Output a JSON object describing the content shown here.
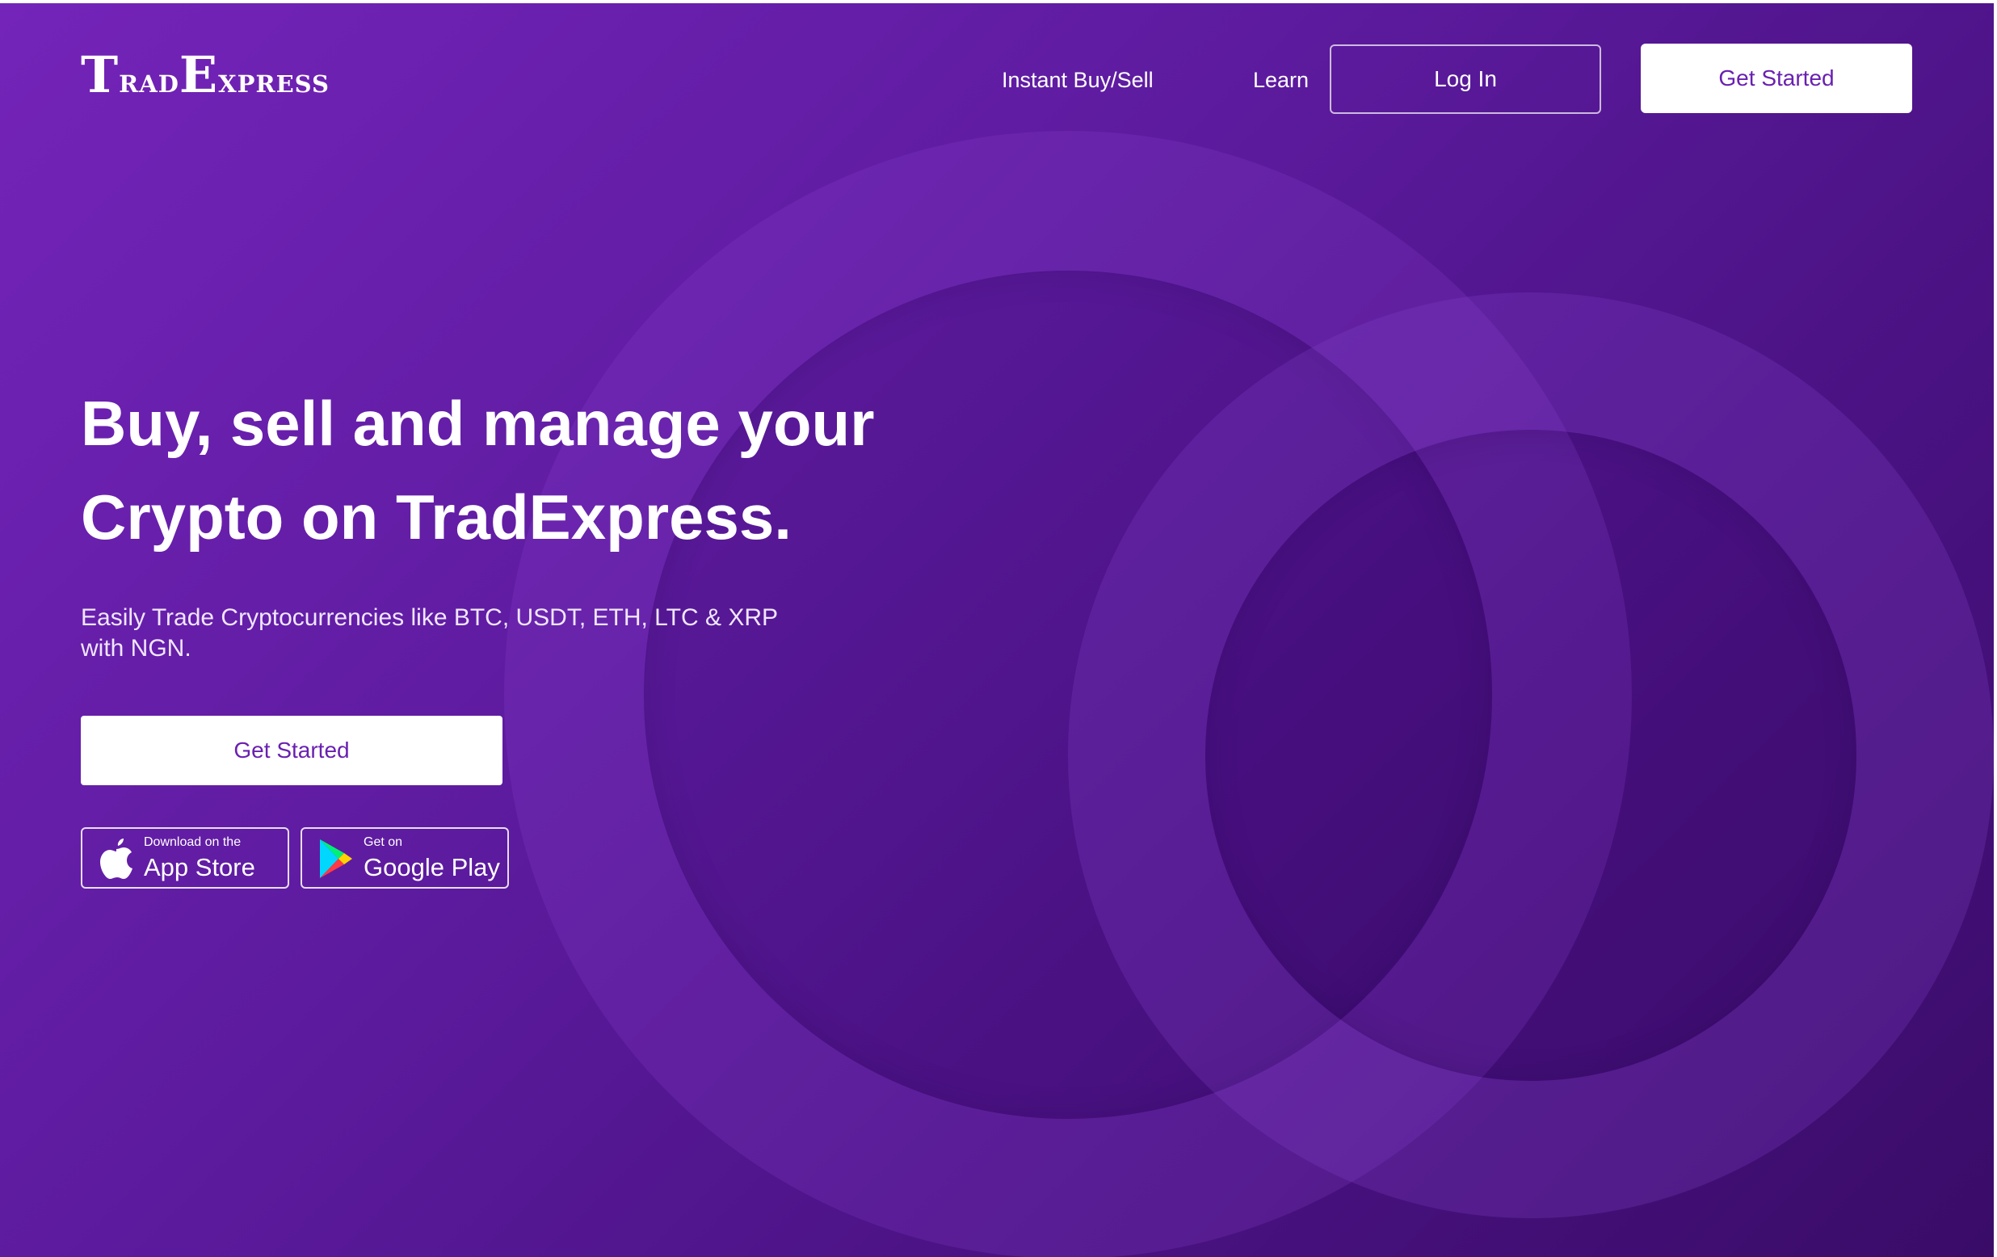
{
  "brand": {
    "logo_first_letter": "T",
    "logo_rest_first": "rad",
    "logo_second_letter": "E",
    "logo_rest_second": "xpress"
  },
  "nav": {
    "instant_label": "Instant Buy/Sell",
    "learn_label": "Learn",
    "login_label": "Log In",
    "get_started_label": "Get Started"
  },
  "hero": {
    "headline_line1": "Buy, sell and manage your",
    "headline_line2": "Crypto on TradExpress.",
    "subtext": "Easily Trade Cryptocurrencies like BTC, USDT, ETH, LTC & XRP with NGN.",
    "cta_label": "Get Started"
  },
  "stores": {
    "apple_small": "Download on the",
    "apple_large": "App Store",
    "apple_icon": "apple-icon",
    "google_small": "Get on",
    "google_large": "Google Play",
    "google_icon": "google-play-icon"
  },
  "colors": {
    "background_start": "#7424b9",
    "background_end": "#3a0c68",
    "accent_text": "#6a20b0",
    "button_fill": "#ffffff"
  }
}
